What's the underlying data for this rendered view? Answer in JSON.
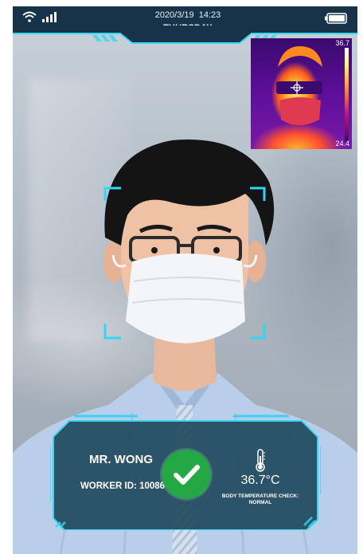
{
  "status_bar": {
    "date": "2020/3/19",
    "time": "14:23",
    "day": "THURSDAY",
    "icons": [
      "wifi-icon",
      "signal-icon",
      "battery-icon"
    ]
  },
  "thermal_view": {
    "scale_max": "36.7",
    "scale_min": "24.4"
  },
  "result_card": {
    "name": "MR. WONG",
    "worker_id_label": "WORKER ID",
    "worker_id_sep": ":",
    "worker_id": "10086",
    "status_icon": "check-icon",
    "temperature": "36.7°C",
    "temperature_label": "BODY TEMPERATURE CHECK:",
    "temperature_status": "NORMAL"
  },
  "colors": {
    "header_bg": "#17334a",
    "accent_cyan": "#36d6f0",
    "card_bg": "#1f4a5c",
    "pass_green": "#23a844"
  }
}
